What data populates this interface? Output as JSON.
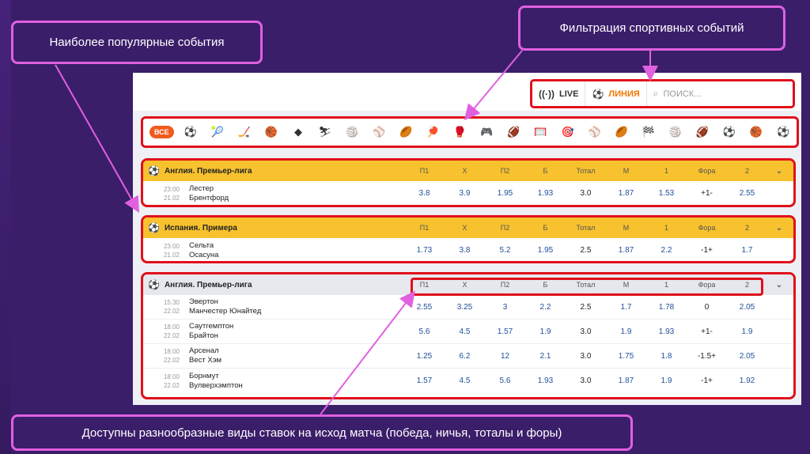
{
  "callouts": {
    "popular": "Наиболее популярные события",
    "filter": "Фильтрация спортивных событий",
    "bets": "Доступны разнообразные виды ставок на исход матча (победа, ничья, тоталы и форы)"
  },
  "topbar": {
    "live_label": "LIVE",
    "line_label": "ЛИНИЯ",
    "search_placeholder": "ПОИСК..."
  },
  "sports": {
    "all_label": "ВСЕ",
    "icons": [
      "⚽",
      "🎾",
      "🏒",
      "🏀",
      "◆",
      "⛷",
      "🏐",
      "⚾",
      "🏉",
      "🏓",
      "🥊",
      "🎮",
      "🏈",
      "🥅",
      "🎯",
      "⚾",
      "🏉",
      "🏁",
      "🏐",
      "🏈",
      "⚽",
      "🏀",
      "⚽"
    ]
  },
  "columns": [
    "П1",
    "Х",
    "П2",
    "Б",
    "Тотал",
    "М",
    "1",
    "Фора",
    "2"
  ],
  "groups": [
    {
      "league": "Англия. Премьер-лига",
      "highlight": true,
      "matches": [
        {
          "time": "23:00",
          "date": "21.02",
          "home": "Лестер",
          "away": "Брентфорд",
          "odds": [
            "3.8",
            "3.9",
            "1.95",
            "1.93",
            "3.0",
            "1.87",
            "1.53",
            "+1-",
            "2.55"
          ]
        }
      ]
    },
    {
      "league": "Испания. Примера",
      "highlight": true,
      "matches": [
        {
          "time": "23:00",
          "date": "21.02",
          "home": "Сельта",
          "away": "Осасуна",
          "odds": [
            "1.73",
            "3.8",
            "5.2",
            "1.95",
            "2.5",
            "1.87",
            "2.2",
            "-1+",
            "1.7"
          ]
        }
      ]
    },
    {
      "league": "Англия. Премьер-лига",
      "highlight": false,
      "matches": [
        {
          "time": "15:30",
          "date": "22.02",
          "home": "Эвертон",
          "away": "Манчестер Юнайтед",
          "odds": [
            "2.55",
            "3.25",
            "3",
            "2.2",
            "2.5",
            "1.7",
            "1.78",
            "0",
            "2.05"
          ]
        },
        {
          "time": "18:00",
          "date": "22.02",
          "home": "Саутгемптон",
          "away": "Брайтон",
          "odds": [
            "5.6",
            "4.5",
            "1.57",
            "1.9",
            "3.0",
            "1.9",
            "1.93",
            "+1-",
            "1.9"
          ]
        },
        {
          "time": "18:00",
          "date": "22.02",
          "home": "Арсенал",
          "away": "Вест Хэм",
          "odds": [
            "1.25",
            "6.2",
            "12",
            "2.1",
            "3.0",
            "1.75",
            "1.8",
            "-1.5+",
            "2.05"
          ]
        },
        {
          "time": "18:00",
          "date": "22.02",
          "home": "Борнмут",
          "away": "Вулверхэмптон",
          "odds": [
            "1.57",
            "4.5",
            "5.6",
            "1.93",
            "3.0",
            "1.87",
            "1.9",
            "-1+",
            "1.92"
          ]
        }
      ]
    }
  ],
  "colors": {
    "background": "#3b1e6a",
    "callout_border": "#e060e0",
    "highlight_red": "#e0101a",
    "league_yellow": "#f7c22e",
    "odds_blue": "#1f4f9a",
    "line_orange": "#f07800"
  }
}
